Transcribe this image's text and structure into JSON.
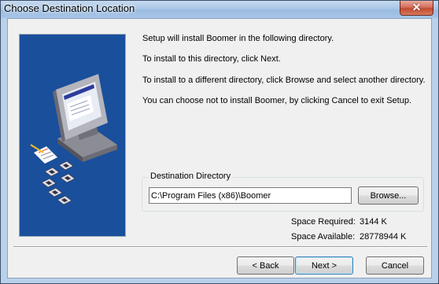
{
  "window": {
    "title": "Choose Destination Location",
    "close_glyph": "✕"
  },
  "messages": [
    "Setup will install Boomer in the following directory.",
    "To install to this directory, click Next.",
    "To install to a different directory, click Browse and select another directory.",
    "You can choose not to install Boomer, by clicking Cancel to exit Setup."
  ],
  "destination": {
    "group_label": "Destination Directory",
    "path": "C:\\Program Files (x86)\\Boomer",
    "browse_label": "Browse..."
  },
  "space": {
    "required_label": "Space Required:",
    "required_value": "3144 K",
    "available_label": "Space Available:",
    "available_value": "28778944 K"
  },
  "buttons": {
    "back": "< Back",
    "next": "Next >",
    "cancel": "Cancel"
  },
  "colors": {
    "side_panel": "#1a4f9c",
    "title_bar": "#b9d1ea",
    "close_button": "#c24a31"
  }
}
